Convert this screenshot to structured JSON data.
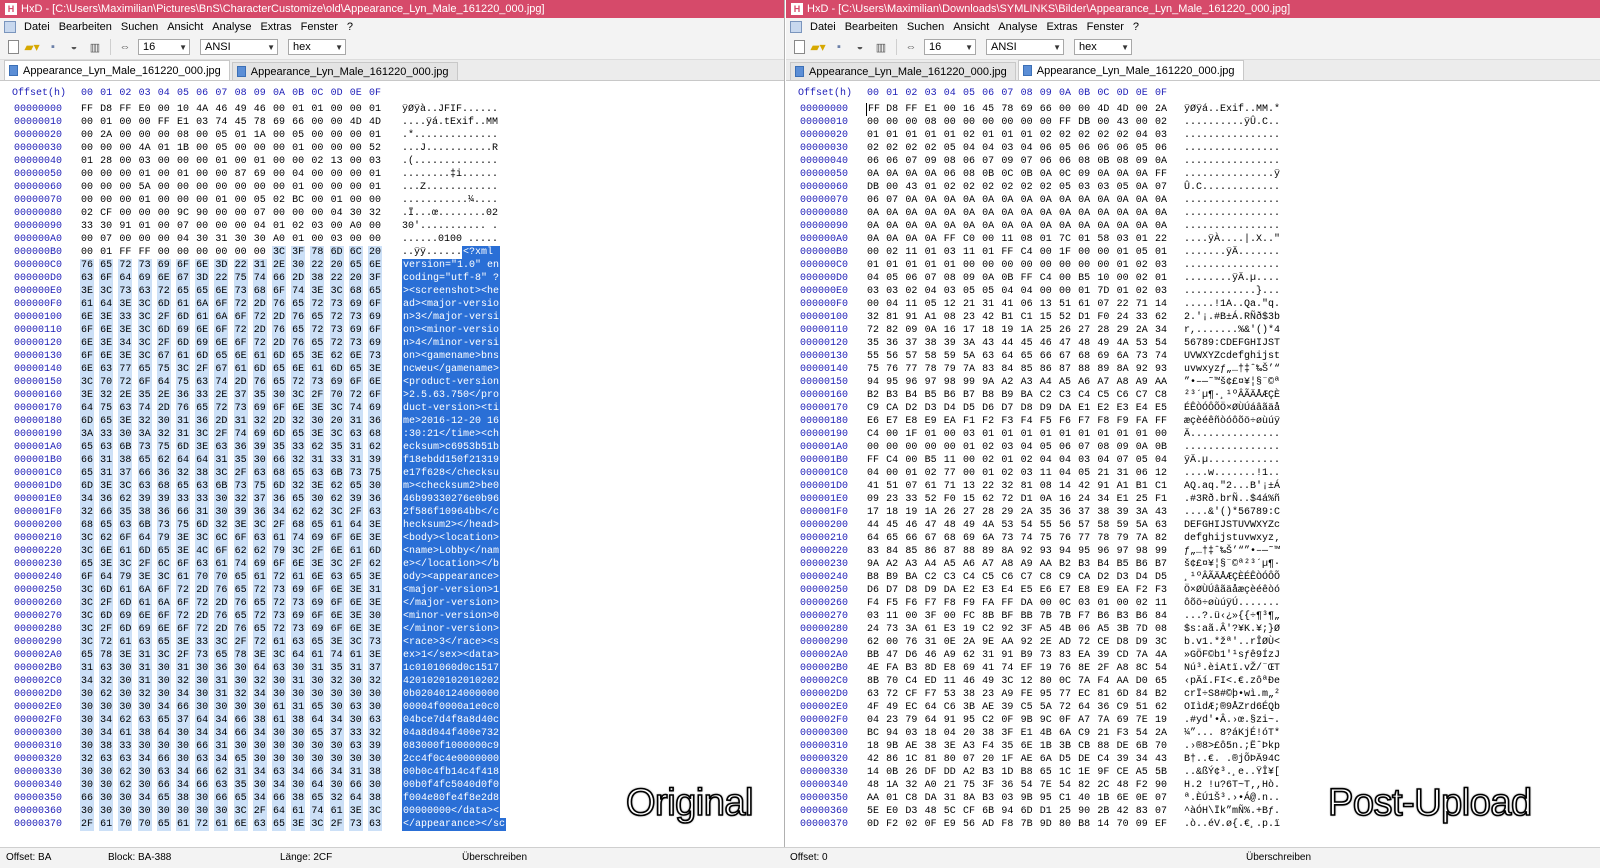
{
  "left": {
    "title": "HxD - [C:\\Users\\Maximilian\\Pictures\\BnS\\CharacterCustomize\\old\\Appearance_Lyn_Male_161220_000.jpg]",
    "menu": [
      "Datei",
      "Bearbeiten",
      "Suchen",
      "Ansicht",
      "Analyse",
      "Extras",
      "Fenster",
      "?"
    ],
    "bytes_per_row": "16",
    "charset": "ANSI",
    "display": "hex",
    "tabs": [
      "Appearance_Lyn_Male_161220_000.jpg",
      "Appearance_Lyn_Male_161220_000.jpg"
    ],
    "active_tab": 0,
    "header": {
      "offset_label": "Offset(h)",
      "columns": [
        "00",
        "01",
        "02",
        "03",
        "04",
        "05",
        "06",
        "07",
        "08",
        "09",
        "0A",
        "0B",
        "0C",
        "0D",
        "0E",
        "0F"
      ]
    },
    "rows": [
      {
        "off": "00000000",
        "hex": "FF D8 FF E0 00 10 4A 46 49 46 00 01 01 00 00 01",
        "ascii": "ÿØÿà..JFIF......"
      },
      {
        "off": "00000010",
        "hex": "00 01 00 00 FF E1 03 74 45 78 69 66 00 00 4D 4D",
        "ascii": "....ÿá.tExif..MM"
      },
      {
        "off": "00000020",
        "hex": "00 2A 00 00 00 08 00 05 01 1A 00 05 00 00 00 01",
        "ascii": ".*.............."
      },
      {
        "off": "00000030",
        "hex": "00 00 00 4A 01 1B 00 05 00 00 00 01 00 00 00 52",
        "ascii": "...J...........R"
      },
      {
        "off": "00000040",
        "hex": "01 28 00 03 00 00 00 01 00 01 00 00 02 13 00 03",
        "ascii": ".(.............."
      },
      {
        "off": "00000050",
        "hex": "00 00 00 01 00 01 00 00 87 69 00 04 00 00 00 01",
        "ascii": "........‡i......"
      },
      {
        "off": "00000060",
        "hex": "00 00 00 5A 00 00 00 00 00 00 00 01 00 00 00 01",
        "ascii": "...Z............"
      },
      {
        "off": "00000070",
        "hex": "00 00 00 01 00 00 00 01 00 05 02 BC 00 01 00 00",
        "ascii": "...........¼...."
      },
      {
        "off": "00000080",
        "hex": "02 CF 00 00 00 9C 90 00 00 07 00 00 00 04 30 32",
        "ascii": ".Ï...œ........02"
      },
      {
        "off": "00000090",
        "hex": "33 30 91 01 00 07 00 00 00 04 01 02 03 00 A0 00",
        "ascii": "30'........... ."
      },
      {
        "off": "000000A0",
        "hex": "00 07 00 00 00 04 30 31 30 30 A0 01 00 03 00 00",
        "ascii": "......0100 ....."
      },
      {
        "off": "000000B0",
        "hex": "00 01 FF FF 00 00 00 00 00 00 3C 3F 78 6D 6C 20",
        "ascii": "..ÿÿ......",
        "sel_ascii": "<?xml "
      },
      {
        "off": "000000C0",
        "hex": "76 65 72 73 69 6F 6E 3D 22 31 2E 30 22 20 65 6E",
        "sel_ascii": "version=\"1.0\" en"
      },
      {
        "off": "000000D0",
        "hex": "63 6F 64 69 6E 67 3D 22 75 74 66 2D 38 22 20 3F",
        "sel_ascii": "coding=\"utf-8\" ?"
      },
      {
        "off": "000000E0",
        "hex": "3E 3C 73 63 72 65 65 6E 73 68 6F 74 3E 3C 68 65",
        "sel_ascii": "><screenshot><he"
      },
      {
        "off": "000000F0",
        "hex": "61 64 3E 3C 6D 61 6A 6F 72 2D 76 65 72 73 69 6F",
        "sel_ascii": "ad><major-versio"
      },
      {
        "off": "00000100",
        "hex": "6E 3E 33 3C 2F 6D 61 6A 6F 72 2D 76 65 72 73 69",
        "sel_ascii": "n>3</major-versi"
      },
      {
        "off": "00000110",
        "hex": "6F 6E 3E 3C 6D 69 6E 6F 72 2D 76 65 72 73 69 6F",
        "sel_ascii": "on><minor-versio"
      },
      {
        "off": "00000120",
        "hex": "6E 3E 34 3C 2F 6D 69 6E 6F 72 2D 76 65 72 73 69",
        "sel_ascii": "n>4</minor-versi"
      },
      {
        "off": "00000130",
        "hex": "6F 6E 3E 3C 67 61 6D 65 6E 61 6D 65 3E 62 6E 73",
        "sel_ascii": "on><gamename>bns"
      },
      {
        "off": "00000140",
        "hex": "6E 63 77 65 75 3C 2F 67 61 6D 65 6E 61 6D 65 3E",
        "sel_ascii": "ncweu</gamename>"
      },
      {
        "off": "00000150",
        "hex": "3C 70 72 6F 64 75 63 74 2D 76 65 72 73 69 6F 6E",
        "sel_ascii": "<product-version"
      },
      {
        "off": "00000160",
        "hex": "3E 32 2E 35 2E 36 33 2E 37 35 30 3C 2F 70 72 6F",
        "sel_ascii": ">2.5.63.750</pro"
      },
      {
        "off": "00000170",
        "hex": "64 75 63 74 2D 76 65 72 73 69 6F 6E 3E 3C 74 69",
        "sel_ascii": "duct-version><ti"
      },
      {
        "off": "00000180",
        "hex": "6D 65 3E 32 30 31 36 2D 31 32 2D 32 30 20 31 36",
        "sel_ascii": "me>2016-12-20 16"
      },
      {
        "off": "00000190",
        "hex": "3A 33 30 3A 32 31 3C 2F 74 69 6D 65 3E 3C 63 68",
        "sel_ascii": ":30:21</time><ch"
      },
      {
        "off": "000001A0",
        "hex": "65 63 6B 73 75 6D 3E 63 36 39 35 33 62 35 31 62",
        "sel_ascii": "ecksum>c6953b51b"
      },
      {
        "off": "000001B0",
        "hex": "66 31 38 65 62 64 64 31 35 30 66 32 31 33 31 39",
        "sel_ascii": "f18ebdd150f21319"
      },
      {
        "off": "000001C0",
        "hex": "65 31 37 66 36 32 38 3C 2F 63 68 65 63 6B 73 75",
        "sel_ascii": "e17f628</checksu"
      },
      {
        "off": "000001D0",
        "hex": "6D 3E 3C 63 68 65 63 6B 73 75 6D 32 3E 62 65 30",
        "sel_ascii": "m><checksum2>be0"
      },
      {
        "off": "000001E0",
        "hex": "34 36 62 39 39 33 33 30 32 37 36 65 30 62 39 36",
        "sel_ascii": "46b99330276e0b96"
      },
      {
        "off": "000001F0",
        "hex": "32 66 35 38 36 66 31 30 39 36 34 62 62 3C 2F 63",
        "sel_ascii": "2f586f10964bb</c"
      },
      {
        "off": "00000200",
        "hex": "68 65 63 6B 73 75 6D 32 3E 3C 2F 68 65 61 64 3E",
        "sel_ascii": "hecksum2></head>"
      },
      {
        "off": "00000210",
        "hex": "3C 62 6F 64 79 3E 3C 6C 6F 63 61 74 69 6F 6E 3E",
        "sel_ascii": "<body><location>"
      },
      {
        "off": "00000220",
        "hex": "3C 6E 61 6D 65 3E 4C 6F 62 62 79 3C 2F 6E 61 6D",
        "sel_ascii": "<name>Lobby</nam"
      },
      {
        "off": "00000230",
        "hex": "65 3E 3C 2F 6C 6F 63 61 74 69 6F 6E 3E 3C 2F 62",
        "sel_ascii": "e></location></b"
      },
      {
        "off": "00000240",
        "hex": "6F 64 79 3E 3C 61 70 70 65 61 72 61 6E 63 65 3E",
        "sel_ascii": "ody><appearance>"
      },
      {
        "off": "00000250",
        "hex": "3C 6D 61 6A 6F 72 2D 76 65 72 73 69 6F 6E 3E 31",
        "sel_ascii": "<major-version>1"
      },
      {
        "off": "00000260",
        "hex": "3C 2F 6D 61 6A 6F 72 2D 76 65 72 73 69 6F 6E 3E",
        "sel_ascii": "</major-version>"
      },
      {
        "off": "00000270",
        "hex": "3C 6D 69 6E 6F 72 2D 76 65 72 73 69 6F 6E 3E 30",
        "sel_ascii": "<minor-version>0"
      },
      {
        "off": "00000280",
        "hex": "3C 2F 6D 69 6E 6F 72 2D 76 65 72 73 69 6F 6E 3E",
        "sel_ascii": "</minor-version>"
      },
      {
        "off": "00000290",
        "hex": "3C 72 61 63 65 3E 33 3C 2F 72 61 63 65 3E 3C 73",
        "sel_ascii": "<race>3</race><s"
      },
      {
        "off": "000002A0",
        "hex": "65 78 3E 31 3C 2F 73 65 78 3E 3C 64 61 74 61 3E",
        "sel_ascii": "ex>1</sex><data>"
      },
      {
        "off": "000002B0",
        "hex": "31 63 30 31 30 31 30 36 30 64 63 30 31 35 31 37",
        "sel_ascii": "1c0101060d0c1517"
      },
      {
        "off": "000002C0",
        "hex": "34 32 30 31 30 32 30 31 30 32 30 31 30 32 30 32",
        "sel_ascii": "4201020102010202"
      },
      {
        "off": "000002D0",
        "hex": "30 62 30 32 30 34 30 31 32 34 30 30 30 30 30 30",
        "sel_ascii": "0b02040124000000"
      },
      {
        "off": "000002E0",
        "hex": "30 30 30 30 34 66 30 30 30 30 61 31 65 30 63 30",
        "sel_ascii": "00004f0000a1e0c0"
      },
      {
        "off": "000002F0",
        "hex": "30 34 62 63 65 37 64 34 66 38 61 38 64 34 30 63",
        "sel_ascii": "04bce7d4f8a8d40c"
      },
      {
        "off": "00000300",
        "hex": "30 34 61 38 64 30 34 34 66 34 30 30 65 37 33 32",
        "sel_ascii": "04a8d044f400e732"
      },
      {
        "off": "00000310",
        "hex": "30 38 33 30 30 30 66 31 30 30 30 30 30 30 63 39",
        "sel_ascii": "083000f1000000c9"
      },
      {
        "off": "00000320",
        "hex": "32 63 63 34 66 30 63 34 65 30 30 30 30 30 30 30",
        "sel_ascii": "2cc4f0c4e0000000"
      },
      {
        "off": "00000330",
        "hex": "30 30 62 30 63 34 66 62 31 34 63 34 66 34 31 38",
        "sel_ascii": "00b0c4fb14c4f418"
      },
      {
        "off": "00000340",
        "hex": "30 30 62 30 66 34 66 63 35 30 34 30 64 30 66 30",
        "sel_ascii": "00b0f4fc5040d0f0"
      },
      {
        "off": "00000350",
        "hex": "66 30 30 34 65 38 30 66 65 34 66 38 65 32 64 38",
        "sel_ascii": "f004e80fe4f8e2d8"
      },
      {
        "off": "00000360",
        "hex": "30 30 30 30 30 30 30 30 3C 2F 64 61 74 61 3E 3C",
        "sel_ascii": "00000000</data><"
      },
      {
        "off": "00000370",
        "hex": "2F 61 70 70 65 61 72 61 6E 63 65 3E 3C 2F 73 63",
        "sel_ascii": "</appearance></sc"
      }
    ],
    "status": {
      "offset": "Offset: BA",
      "block": "Block: BA-388",
      "length": "Länge: 2CF",
      "mode": "Überschreiben"
    },
    "watermark": "Original"
  },
  "right": {
    "title": "HxD - [C:\\Users\\Maximilian\\Downloads\\SYMLINKS\\Bilder\\Appearance_Lyn_Male_161220_000.jpg]",
    "menu": [
      "Datei",
      "Bearbeiten",
      "Suchen",
      "Ansicht",
      "Analyse",
      "Extras",
      "Fenster",
      "?"
    ],
    "bytes_per_row": "16",
    "charset": "ANSI",
    "display": "hex",
    "tabs": [
      "Appearance_Lyn_Male_161220_000.jpg",
      "Appearance_Lyn_Male_161220_000.jpg"
    ],
    "active_tab": 1,
    "header": {
      "offset_label": "Offset(h)",
      "columns": [
        "00",
        "01",
        "02",
        "03",
        "04",
        "05",
        "06",
        "07",
        "08",
        "09",
        "0A",
        "0B",
        "0C",
        "0D",
        "0E",
        "0F"
      ]
    },
    "rows": [
      {
        "off": "00000000",
        "hex": "FF D8 FF E1 00 16 45 78 69 66 00 00 4D 4D 00 2A",
        "ascii": "ÿØÿá..Exif..MM.*"
      },
      {
        "off": "00000010",
        "hex": "00 00 00 08 00 00 00 00 00 00 FF DB 00 43 00 02",
        "ascii": "..........ÿÛ.C.."
      },
      {
        "off": "00000020",
        "hex": "01 01 01 01 01 02 01 01 01 02 02 02 02 02 04 03",
        "ascii": "................"
      },
      {
        "off": "00000030",
        "hex": "02 02 02 02 05 04 04 03 04 06 05 06 06 06 05 06",
        "ascii": "................"
      },
      {
        "off": "00000040",
        "hex": "06 06 07 09 08 06 07 09 07 06 06 08 0B 08 09 0A",
        "ascii": "................"
      },
      {
        "off": "00000050",
        "hex": "0A 0A 0A 0A 06 08 0B 0C 0B 0A 0C 09 0A 0A 0A FF",
        "ascii": "...............ÿ"
      },
      {
        "off": "00000060",
        "hex": "DB 00 43 01 02 02 02 02 02 02 05 03 03 05 0A 07",
        "ascii": "Û.C............."
      },
      {
        "off": "00000070",
        "hex": "06 07 0A 0A 0A 0A 0A 0A 0A 0A 0A 0A 0A 0A 0A 0A",
        "ascii": "................"
      },
      {
        "off": "00000080",
        "hex": "0A 0A 0A 0A 0A 0A 0A 0A 0A 0A 0A 0A 0A 0A 0A 0A",
        "ascii": "................"
      },
      {
        "off": "00000090",
        "hex": "0A 0A 0A 0A 0A 0A 0A 0A 0A 0A 0A 0A 0A 0A 0A 0A",
        "ascii": "................"
      },
      {
        "off": "000000A0",
        "hex": "0A 0A 0A 0A FF C0 00 11 08 01 7C 01 58 03 01 22",
        "ascii": "....ÿÀ....|.X..\""
      },
      {
        "off": "000000B0",
        "hex": "00 02 11 01 03 11 01 FF C4 00 1F 00 00 01 05 01",
        "ascii": ".......ÿÄ......."
      },
      {
        "off": "000000C0",
        "hex": "01 01 01 01 01 00 00 00 00 00 00 00 00 01 02 03",
        "ascii": "................"
      },
      {
        "off": "000000D0",
        "hex": "04 05 06 07 08 09 0A 0B FF C4 00 B5 10 00 02 01",
        "ascii": "........ÿÄ.µ...."
      },
      {
        "off": "000000E0",
        "hex": "03 03 02 04 03 05 05 04 04 00 00 01 7D 01 02 03",
        "ascii": "............}..."
      },
      {
        "off": "000000F0",
        "hex": "00 04 11 05 12 21 31 41 06 13 51 61 07 22 71 14",
        "ascii": ".....!1A..Qa.\"q."
      },
      {
        "off": "00000100",
        "hex": "32 81 91 A1 08 23 42 B1 C1 15 52 D1 F0 24 33 62",
        "ascii": "2.'¡.#B±Á.RÑð$3b"
      },
      {
        "off": "00000110",
        "hex": "72 82 09 0A 16 17 18 19 1A 25 26 27 28 29 2A 34",
        "ascii": "r,.......%&'()*4"
      },
      {
        "off": "00000120",
        "hex": "35 36 37 38 39 3A 43 44 45 46 47 48 49 4A 53 54",
        "ascii": "56789:CDEFGHIJST"
      },
      {
        "off": "00000130",
        "hex": "55 56 57 58 59 5A 63 64 65 66 67 68 69 6A 73 74",
        "ascii": "UVWXYZcdefghijst"
      },
      {
        "off": "00000140",
        "hex": "75 76 77 78 79 7A 83 84 85 86 87 88 89 8A 92 93",
        "ascii": "uvwxyzƒ„…†‡ˆ‰Š’“"
      },
      {
        "off": "00000150",
        "hex": "94 95 96 97 98 99 9A A2 A3 A4 A5 A6 A7 A8 A9 AA",
        "ascii": "”•–—˜™š¢£¤¥¦§¨©ª"
      },
      {
        "off": "00000160",
        "hex": "B2 B3 B4 B5 B6 B7 B8 B9 BA C2 C3 C4 C5 C6 C7 C8",
        "ascii": "²³´µ¶·¸¹ºÂÃÄÅÆÇÈ"
      },
      {
        "off": "00000170",
        "hex": "C9 CA D2 D3 D4 D5 D6 D7 D8 D9 DA E1 E2 E3 E4 E5",
        "ascii": "ÉÊÒÓÔÕÖ×ØÙÚáâãäå"
      },
      {
        "off": "00000180",
        "hex": "E6 E7 E8 E9 EA F1 F2 F3 F4 F5 F6 F7 F8 F9 FA FF",
        "ascii": "æçèéêñòóôõö÷øùúÿ"
      },
      {
        "off": "00000190",
        "hex": "C4 00 1F 01 00 03 01 01 01 01 01 01 01 01 01 00",
        "ascii": "Ä..............."
      },
      {
        "off": "000001A0",
        "hex": "00 00 00 00 00 01 02 03 04 05 06 07 08 09 0A 0B",
        "ascii": "................"
      },
      {
        "off": "000001B0",
        "hex": "FF C4 00 B5 11 00 02 01 02 04 04 03 04 07 05 04",
        "ascii": "ÿÄ.µ............"
      },
      {
        "off": "000001C0",
        "hex": "04 00 01 02 77 00 01 02 03 11 04 05 21 31 06 12",
        "ascii": "....w.......!1.."
      },
      {
        "off": "000001D0",
        "hex": "41 51 07 61 71 13 22 32 81 08 14 42 91 A1 B1 C1",
        "ascii": "AQ.aq.\"2...B'¡±Á"
      },
      {
        "off": "000001E0",
        "hex": "09 23 33 52 F0 15 62 72 D1 0A 16 24 34 E1 25 F1",
        "ascii": ".#3Rð.brÑ..$4á%ñ"
      },
      {
        "off": "000001F0",
        "hex": "17 18 19 1A 26 27 28 29 2A 35 36 37 38 39 3A 43",
        "ascii": "....&'()*56789:C"
      },
      {
        "off": "00000200",
        "hex": "44 45 46 47 48 49 4A 53 54 55 56 57 58 59 5A 63",
        "ascii": "DEFGHIJSTUVWXYZc"
      },
      {
        "off": "00000210",
        "hex": "64 65 66 67 68 69 6A 73 74 75 76 77 78 79 7A 82",
        "ascii": "defghijstuvwxyz‚"
      },
      {
        "off": "00000220",
        "hex": "83 84 85 86 87 88 89 8A 92 93 94 95 96 97 98 99",
        "ascii": "ƒ„…†‡ˆ‰Š’“”•–—˜™"
      },
      {
        "off": "00000230",
        "hex": "9A A2 A3 A4 A5 A6 A7 A8 A9 AA B2 B3 B4 B5 B6 B7",
        "ascii": "š¢£¤¥¦§¨©ª²³´µ¶·"
      },
      {
        "off": "00000240",
        "hex": "B8 B9 BA C2 C3 C4 C5 C6 C7 C8 C9 CA D2 D3 D4 D5",
        "ascii": "¸¹ºÂÃÄÅÆÇÈÉÊÒÓÔÕ"
      },
      {
        "off": "00000250",
        "hex": "D6 D7 D8 D9 DA E2 E3 E4 E5 E6 E7 E8 E9 EA F2 F3",
        "ascii": "Ö×ØÙÚâãäåæçèéêòó"
      },
      {
        "off": "00000260",
        "hex": "F4 F5 F6 F7 F8 F9 FA FF DA 00 0C 03 01 00 02 11",
        "ascii": "ôõö÷øùúÿÚ......."
      },
      {
        "off": "00000270",
        "hex": "03 11 00 3F 00 FC 8B BF BB 7B 7B F7 B6 B3 B6 84",
        "ascii": "...?.ü‹¿»{{÷¶³¶„"
      },
      {
        "off": "00000280",
        "hex": "24 73 3A 61 E3 19 C2 92 3F A5 4B 06 A5 3B 7D 08",
        "ascii": "$s:aã.Â'?¥K.¥;}Ø"
      },
      {
        "off": "00000290",
        "hex": "62 00 76 31 0E 2A 9E AA 92 2E AD 72 CE D8 D9 3C",
        "ascii": "b.v1.*žª'..rÎØÙ<"
      },
      {
        "off": "000002A0",
        "hex": "BB 47 D6 46 A9 62 31 91 B9 73 83 EA 39 CD 7A 4A",
        "ascii": "»GÖF©b1'¹sƒê9ÍzJ"
      },
      {
        "off": "000002B0",
        "hex": "4E FA B3 8D E8 69 41 74 EF 19 76 8E 2F A8 8C 54",
        "ascii": "Nú³.èiAtï.vŽ/¨ŒT"
      },
      {
        "off": "000002C0",
        "hex": "8B 70 C4 ED 11 46 49 3C 12 80 0C 7A F4 AA D0 65",
        "ascii": "‹pÄí.FI<.€.zôªÐe"
      },
      {
        "off": "000002D0",
        "hex": "63 72 CF F7 53 38 23 A9 FE 95 77 EC 81 6D 84 B2",
        "ascii": "crÏ÷S8#©þ•wì.m„²"
      },
      {
        "off": "000002E0",
        "hex": "4F 49 EC 64 C6 3B AE 39 C5 5A 72 64 36 C9 51 62",
        "ascii": "OIìdÆ;®9ÅZrd6ÉQb"
      },
      {
        "off": "000002F0",
        "hex": "04 23 79 64 91 95 C2 0F 9B 9C 0F A7 7A 69 7E 19",
        "ascii": ".#yd'•Â.›œ.§zi~."
      },
      {
        "off": "00000300",
        "hex": "BC 94 03 18 04 20 38 3F E1 4B 6A C9 21 F3 54 2A",
        "ascii": "¼”... 8?áKjÉ!óT*"
      },
      {
        "off": "00000310",
        "hex": "18 9B AE 38 3E A3 F4 35 6E 1B 3B CB 88 DE 6B 70",
        "ascii": ".›®8>£ô5n.;ËˆÞkp"
      },
      {
        "off": "00000320",
        "hex": "42 86 1C 81 80 07 20 1F AE 6A D5 DE C4 39 34 43",
        "ascii": "B†..€. .®jÕÞÄ94C"
      },
      {
        "off": "00000330",
        "hex": "14 0B 26 DF DD A2 B3 1D B8 65 1C 1E 9F CE A5 5B",
        "ascii": "..&ßÝ¢³.¸e..ŸÎ¥["
      },
      {
        "off": "00000340",
        "hex": "48 1A 32 A0 21 75 3F 36 54 7E 54 82 2C 48 F2 90",
        "ascii": "H.2 !u?6T~T‚,Hò."
      },
      {
        "off": "00000350",
        "hex": "AA 01 C8 DA 31 8A B3 03 9B 95 C1 40 1B 6E 0E 07",
        "ascii": "ª.ÈÚ1Š³.›•Á@.n.."
      },
      {
        "off": "00000360",
        "hex": "5E E0 D3 48 5C CF 6B 94 6D D1 25 90 2B 42 83 07",
        "ascii": "^àÓH\\Ïk”mÑ%.+Bƒ."
      },
      {
        "off": "00000370",
        "hex": "0D F2 02 0F E9 56 AD F8 7B 9D 80 B8 14 70 09 EF",
        "ascii": ".ò..éV.ø{.€¸.p.ï"
      }
    ],
    "status": {
      "offset": "Offset: 0",
      "block": "",
      "length": "",
      "mode": "Überschreiben"
    },
    "watermark": "Post-Upload"
  },
  "colors": {
    "titlebar": "#d64a6a",
    "selection": "#2a6fd6",
    "offset_text": "#2020b8"
  }
}
